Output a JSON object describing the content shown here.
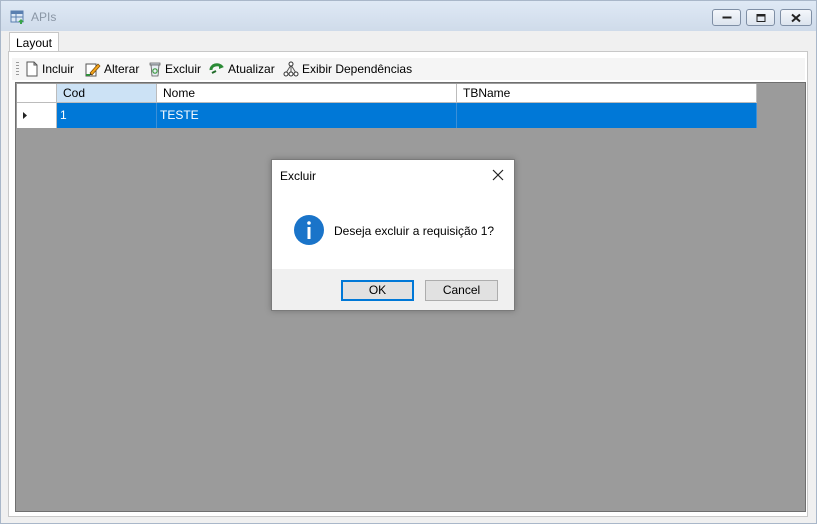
{
  "window": {
    "title": "APIs"
  },
  "tabs": [
    {
      "label": "Layout"
    }
  ],
  "toolbar": {
    "include": "Incluir",
    "edit": "Alterar",
    "delete": "Excluir",
    "refresh": "Atualizar",
    "dependencies": "Exibir Dependências"
  },
  "grid": {
    "columns": [
      "Cod",
      "Nome",
      "TBName"
    ],
    "rows": [
      {
        "cod": "1",
        "nome": "TESTE",
        "tbname": ""
      }
    ]
  },
  "dialog": {
    "title": "Excluir",
    "message": "Deseja excluir a requisição 1?",
    "ok": "OK",
    "cancel": "Cancel",
    "icon": "info-icon"
  },
  "colors": {
    "selection": "#0078d7",
    "grid_background": "#9b9b9b",
    "header_selected": "#cce2f5"
  }
}
